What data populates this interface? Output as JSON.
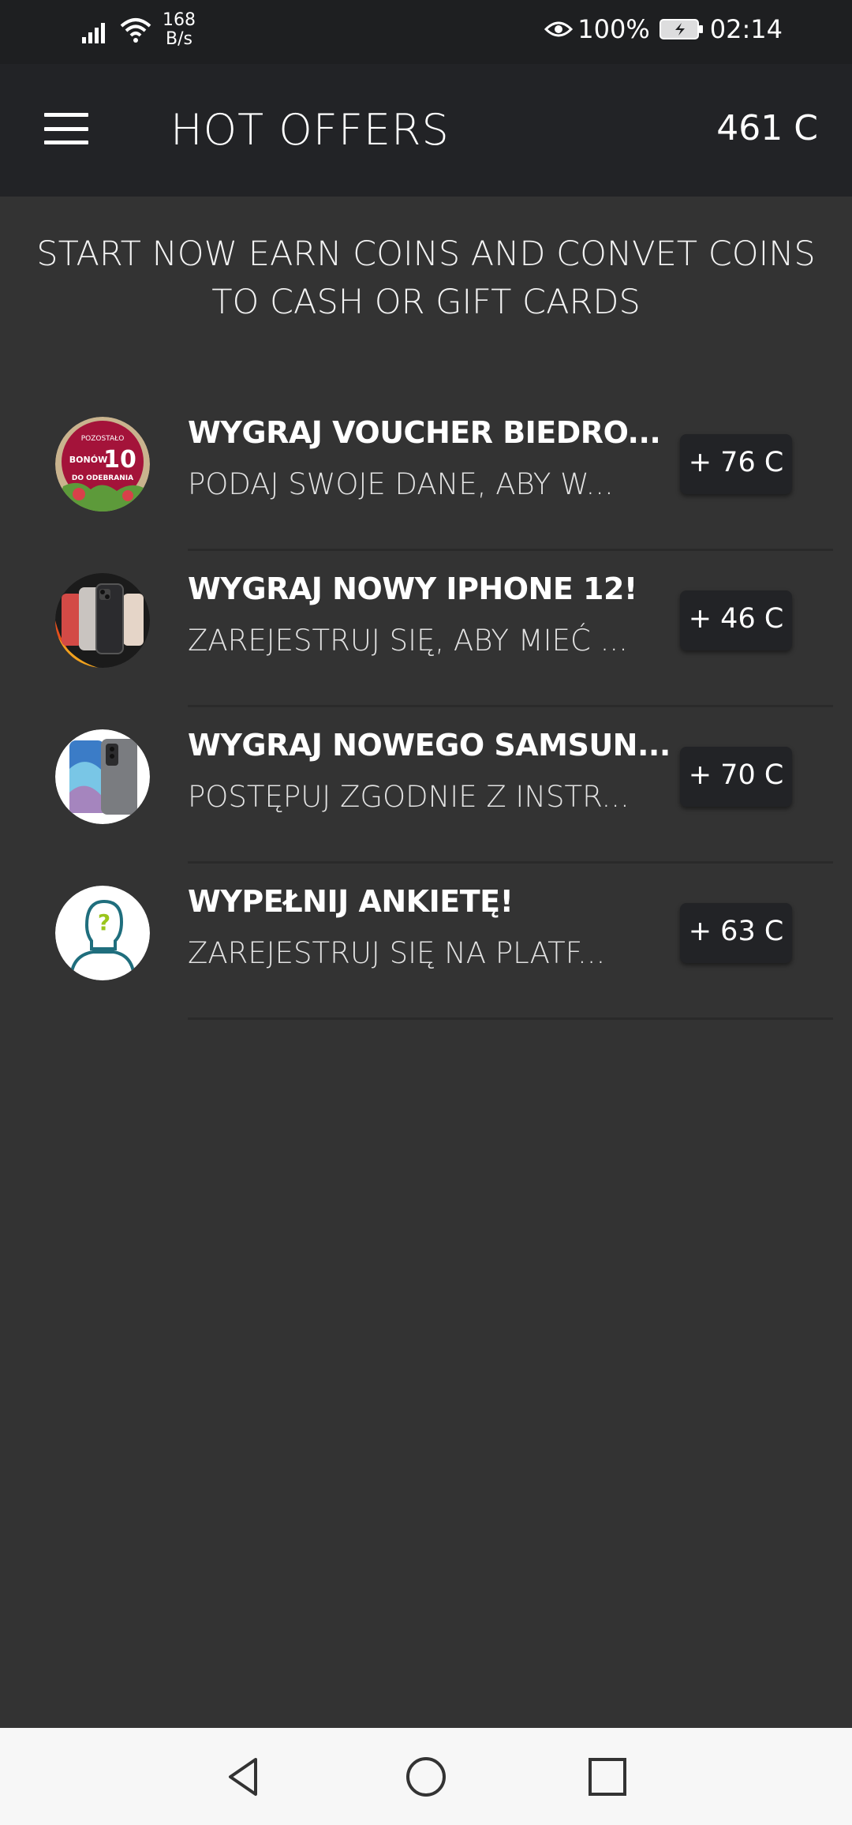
{
  "status_bar": {
    "network_speed_value": "168",
    "network_speed_unit": "B/s",
    "battery": "100%",
    "time": "02:14"
  },
  "header": {
    "title": "HOT OFFERS",
    "coins": "461 C"
  },
  "intro": "START NOW EARN COINS AND CONVET COINS TO CASH OR GIFT CARDS",
  "offers": [
    {
      "title": "WYGRAJ VOUCHER BIEDRO...",
      "description": "PODAJ SWOJE DANE, ABY W...",
      "reward": "+ 76 C",
      "icon_text": {
        "top": "POZOSTAŁO",
        "middle": "BONÓW",
        "number": "10",
        "bottom": "DO ODEBRANIA"
      }
    },
    {
      "title": "WYGRAJ NOWY IPHONE 12!",
      "description": "ZAREJESTRUJ SIĘ, ABY MIEĆ ...",
      "reward": "+ 46 C"
    },
    {
      "title": "WYGRAJ NOWEGO SAMSUN...",
      "description": "POSTĘPUJ ZGODNIE Z INSTR...",
      "reward": "+ 70 C"
    },
    {
      "title": "WYPEŁNIJ ANKIETĘ!",
      "description": "ZAREJESTRUJ SIĘ NA PLATF...",
      "reward": "+ 63 C"
    }
  ],
  "colors": {
    "background": "#333333",
    "app_bar": "#222326",
    "status_bar": "#1e1f21",
    "nav_bar": "#f7f7f7"
  }
}
